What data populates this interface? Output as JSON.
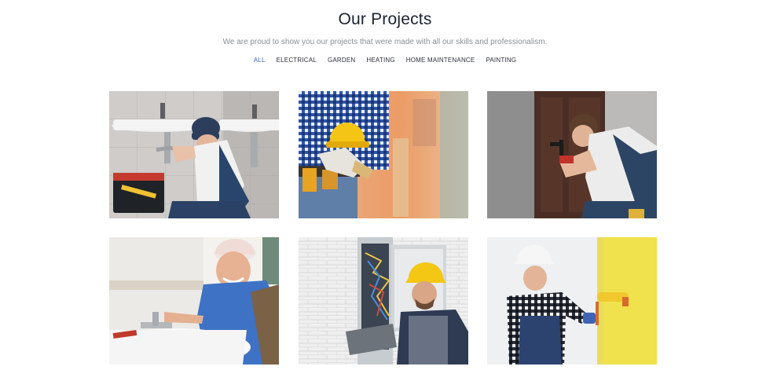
{
  "section": {
    "title": "Our Projects",
    "subtitle": "We are proud to show you our projects that were made with all our skills and professionalism."
  },
  "filters": [
    {
      "label": "ALL",
      "active": true
    },
    {
      "label": "ELECTRICAL",
      "active": false
    },
    {
      "label": "GARDEN",
      "active": false
    },
    {
      "label": "HEATING",
      "active": false
    },
    {
      "label": "HOME MAINTENANCE",
      "active": false
    },
    {
      "label": "PAINTING",
      "active": false
    }
  ],
  "colors": {
    "accent": "#3a6bd4",
    "title": "#1b2232",
    "subtitle": "#8b8f96"
  },
  "projects": [
    {
      "image": "plumber-under-sinks-photo"
    },
    {
      "image": "worker-holding-yellow-helmet-photo"
    },
    {
      "image": "worker-fixing-door-lock-photo"
    },
    {
      "image": "smiling-plumber-at-sink-photo"
    },
    {
      "image": "electrician-at-panel-photo"
    },
    {
      "image": "painter-with-roller-photo"
    }
  ]
}
